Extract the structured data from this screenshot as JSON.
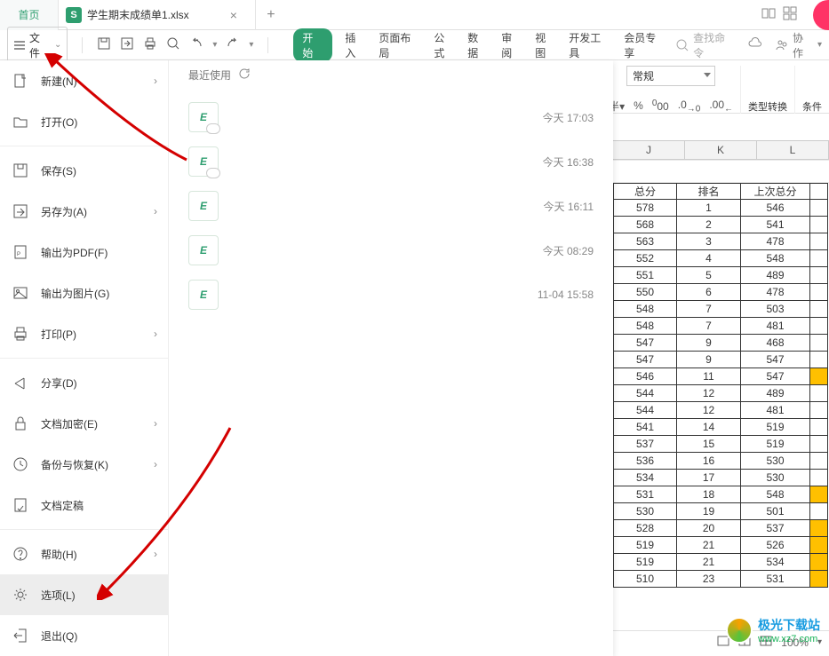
{
  "tabbar": {
    "home": "首页",
    "filename": "学生期末成绩单1.xlsx"
  },
  "toolbar": {
    "file_label": "文件",
    "search_placeholder": "查找命令",
    "coop": "协作",
    "tabs": {
      "start": "开始",
      "insert": "插入",
      "page": "页面布局",
      "formula": "公式",
      "data": "数据",
      "review": "审阅",
      "view": "视图",
      "dev": "开发工具",
      "member": "会员专享"
    }
  },
  "formatbar": {
    "general": "常规",
    "convert": "类型转换",
    "cond": "条件"
  },
  "filemenu": {
    "new": "新建(N)",
    "open": "打开(O)",
    "save": "保存(S)",
    "saveas": "另存为(A)",
    "pdf": "输出为PDF(F)",
    "image": "输出为图片(G)",
    "print": "打印(P)",
    "share": "分享(D)",
    "encrypt": "文档加密(E)",
    "backup": "备份与恢复(K)",
    "draft": "文档定稿",
    "help": "帮助(H)",
    "options": "选项(L)",
    "exit": "退出(Q)"
  },
  "recent": {
    "header": "最近使用",
    "items": [
      {
        "time": "今天  17:03",
        "cloud": true
      },
      {
        "time": "今天  16:38",
        "cloud": true
      },
      {
        "time": "今天  16:11",
        "cloud": false
      },
      {
        "time": "今天  08:29",
        "cloud": false
      },
      {
        "time": "11-04 15:58",
        "cloud": false
      }
    ]
  },
  "sheet": {
    "cols": [
      "J",
      "K",
      "L"
    ],
    "header": [
      "总分",
      "排名",
      "上次总分"
    ],
    "rows": [
      {
        "j": "578",
        "k": "1",
        "l": "546",
        "h": false
      },
      {
        "j": "568",
        "k": "2",
        "l": "541",
        "h": false
      },
      {
        "j": "563",
        "k": "3",
        "l": "478",
        "h": false
      },
      {
        "j": "552",
        "k": "4",
        "l": "548",
        "h": false
      },
      {
        "j": "551",
        "k": "5",
        "l": "489",
        "h": false
      },
      {
        "j": "550",
        "k": "6",
        "l": "478",
        "h": false
      },
      {
        "j": "548",
        "k": "7",
        "l": "503",
        "h": false
      },
      {
        "j": "548",
        "k": "7",
        "l": "481",
        "h": false
      },
      {
        "j": "547",
        "k": "9",
        "l": "468",
        "h": false
      },
      {
        "j": "547",
        "k": "9",
        "l": "547",
        "h": false
      },
      {
        "j": "546",
        "k": "11",
        "l": "547",
        "h": true
      },
      {
        "j": "544",
        "k": "12",
        "l": "489",
        "h": false
      },
      {
        "j": "544",
        "k": "12",
        "l": "481",
        "h": false
      },
      {
        "j": "541",
        "k": "14",
        "l": "519",
        "h": false
      },
      {
        "j": "537",
        "k": "15",
        "l": "519",
        "h": false
      },
      {
        "j": "536",
        "k": "16",
        "l": "530",
        "h": false
      },
      {
        "j": "534",
        "k": "17",
        "l": "530",
        "h": false
      },
      {
        "j": "531",
        "k": "18",
        "l": "548",
        "h": true
      },
      {
        "j": "530",
        "k": "19",
        "l": "501",
        "h": false
      },
      {
        "j": "528",
        "k": "20",
        "l": "537",
        "h": true
      },
      {
        "j": "519",
        "k": "21",
        "l": "526",
        "h": true
      },
      {
        "j": "519",
        "k": "21",
        "l": "534",
        "h": true
      },
      {
        "j": "510",
        "k": "23",
        "l": "531",
        "h": true
      }
    ]
  },
  "statusbar": {
    "zoom": "100%"
  },
  "watermark": {
    "l1": "极光下载站",
    "l2": "www.xz7.com"
  }
}
